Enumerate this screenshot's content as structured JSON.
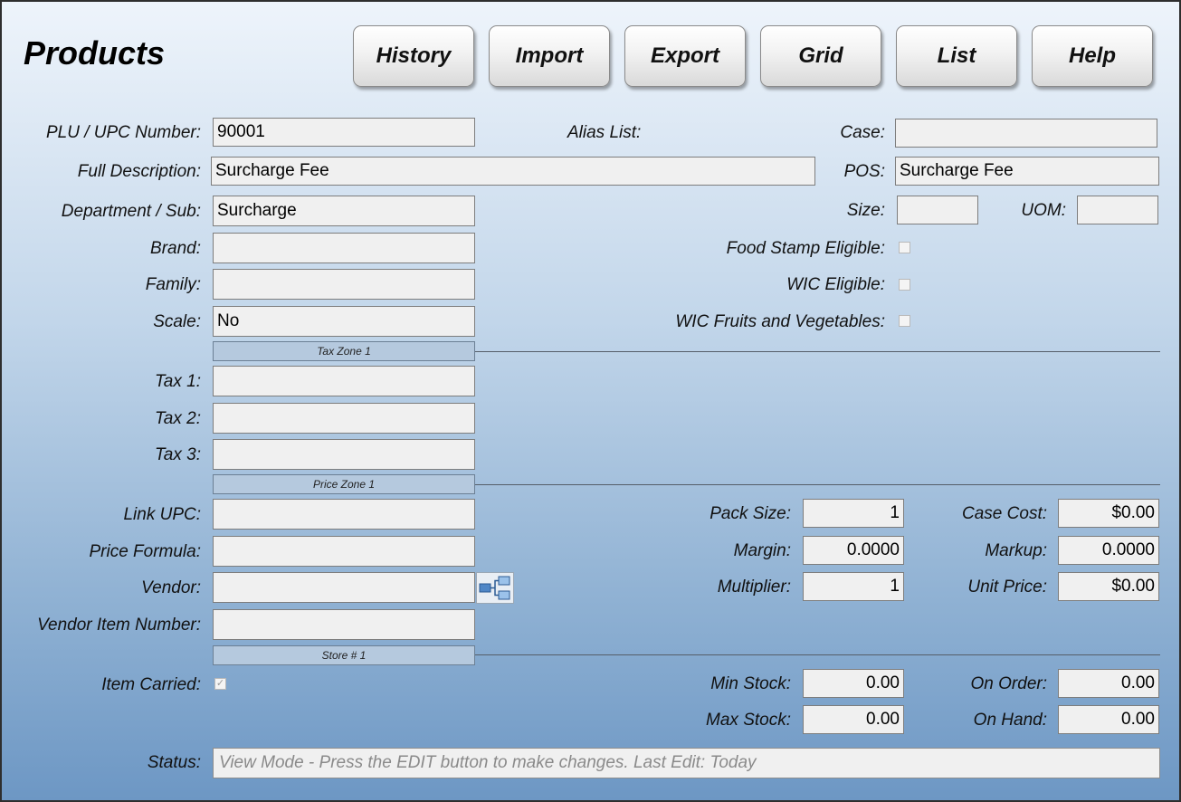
{
  "title": "Products",
  "toolbar": {
    "history": "History",
    "import": "Import",
    "export": "Export",
    "grid": "Grid",
    "list": "List",
    "help": "Help"
  },
  "labels": {
    "plu": "PLU / UPC Number:",
    "alias": "Alias List:",
    "case": "Case:",
    "full_desc": "Full Description:",
    "pos": "POS:",
    "dept": "Department / Sub:",
    "size": "Size:",
    "uom": "UOM:",
    "brand": "Brand:",
    "food_stamp": "Food Stamp Eligible:",
    "family": "Family:",
    "wic": "WIC Eligible:",
    "scale": "Scale:",
    "wic_fv": "WIC Fruits and Vegetables:",
    "tax1": "Tax 1:",
    "tax2": "Tax 2:",
    "tax3": "Tax 3:",
    "link_upc": "Link UPC:",
    "pack_size": "Pack Size:",
    "case_cost": "Case Cost:",
    "price_formula": "Price Formula:",
    "margin": "Margin:",
    "markup": "Markup:",
    "vendor": "Vendor:",
    "multiplier": "Multiplier:",
    "unit_price": "Unit Price:",
    "vendor_item": "Vendor Item Number:",
    "item_carried": "Item Carried:",
    "min_stock": "Min Stock:",
    "on_order": "On Order:",
    "max_stock": "Max Stock:",
    "on_hand": "On Hand:",
    "status": "Status:"
  },
  "values": {
    "plu": "90001",
    "case": "",
    "full_desc": "Surcharge Fee",
    "pos": "Surcharge Fee",
    "dept": "Surcharge",
    "size": "",
    "uom": "",
    "brand": "",
    "family": "",
    "scale": "No",
    "tax1": "",
    "tax2": "",
    "tax3": "",
    "link_upc": "",
    "pack_size": "1",
    "case_cost": "$0.00",
    "price_formula": "",
    "margin": "0.0000",
    "markup": "0.0000",
    "vendor": "",
    "multiplier": "1",
    "unit_price": "$0.00",
    "vendor_item": "",
    "min_stock": "0.00",
    "on_order": "0.00",
    "max_stock": "0.00",
    "on_hand": "0.00",
    "status": "View Mode - Press the EDIT button to make changes. Last Edit: Today"
  },
  "checks": {
    "food_stamp": false,
    "wic": false,
    "wic_fv": false,
    "item_carried": true
  },
  "sections": {
    "tax_zone": "Tax Zone 1",
    "price_zone": "Price Zone 1",
    "store": "Store # 1"
  },
  "icons": {
    "vendor_lookup": "hierarchy-icon",
    "checkmark": "checkmark-icon"
  },
  "colors": {
    "gradient_top": "#eef4fb",
    "gradient_bottom": "#6d97c4",
    "field_bg": "#f0f0f0",
    "section_tag_bg": "#b5c9de"
  }
}
